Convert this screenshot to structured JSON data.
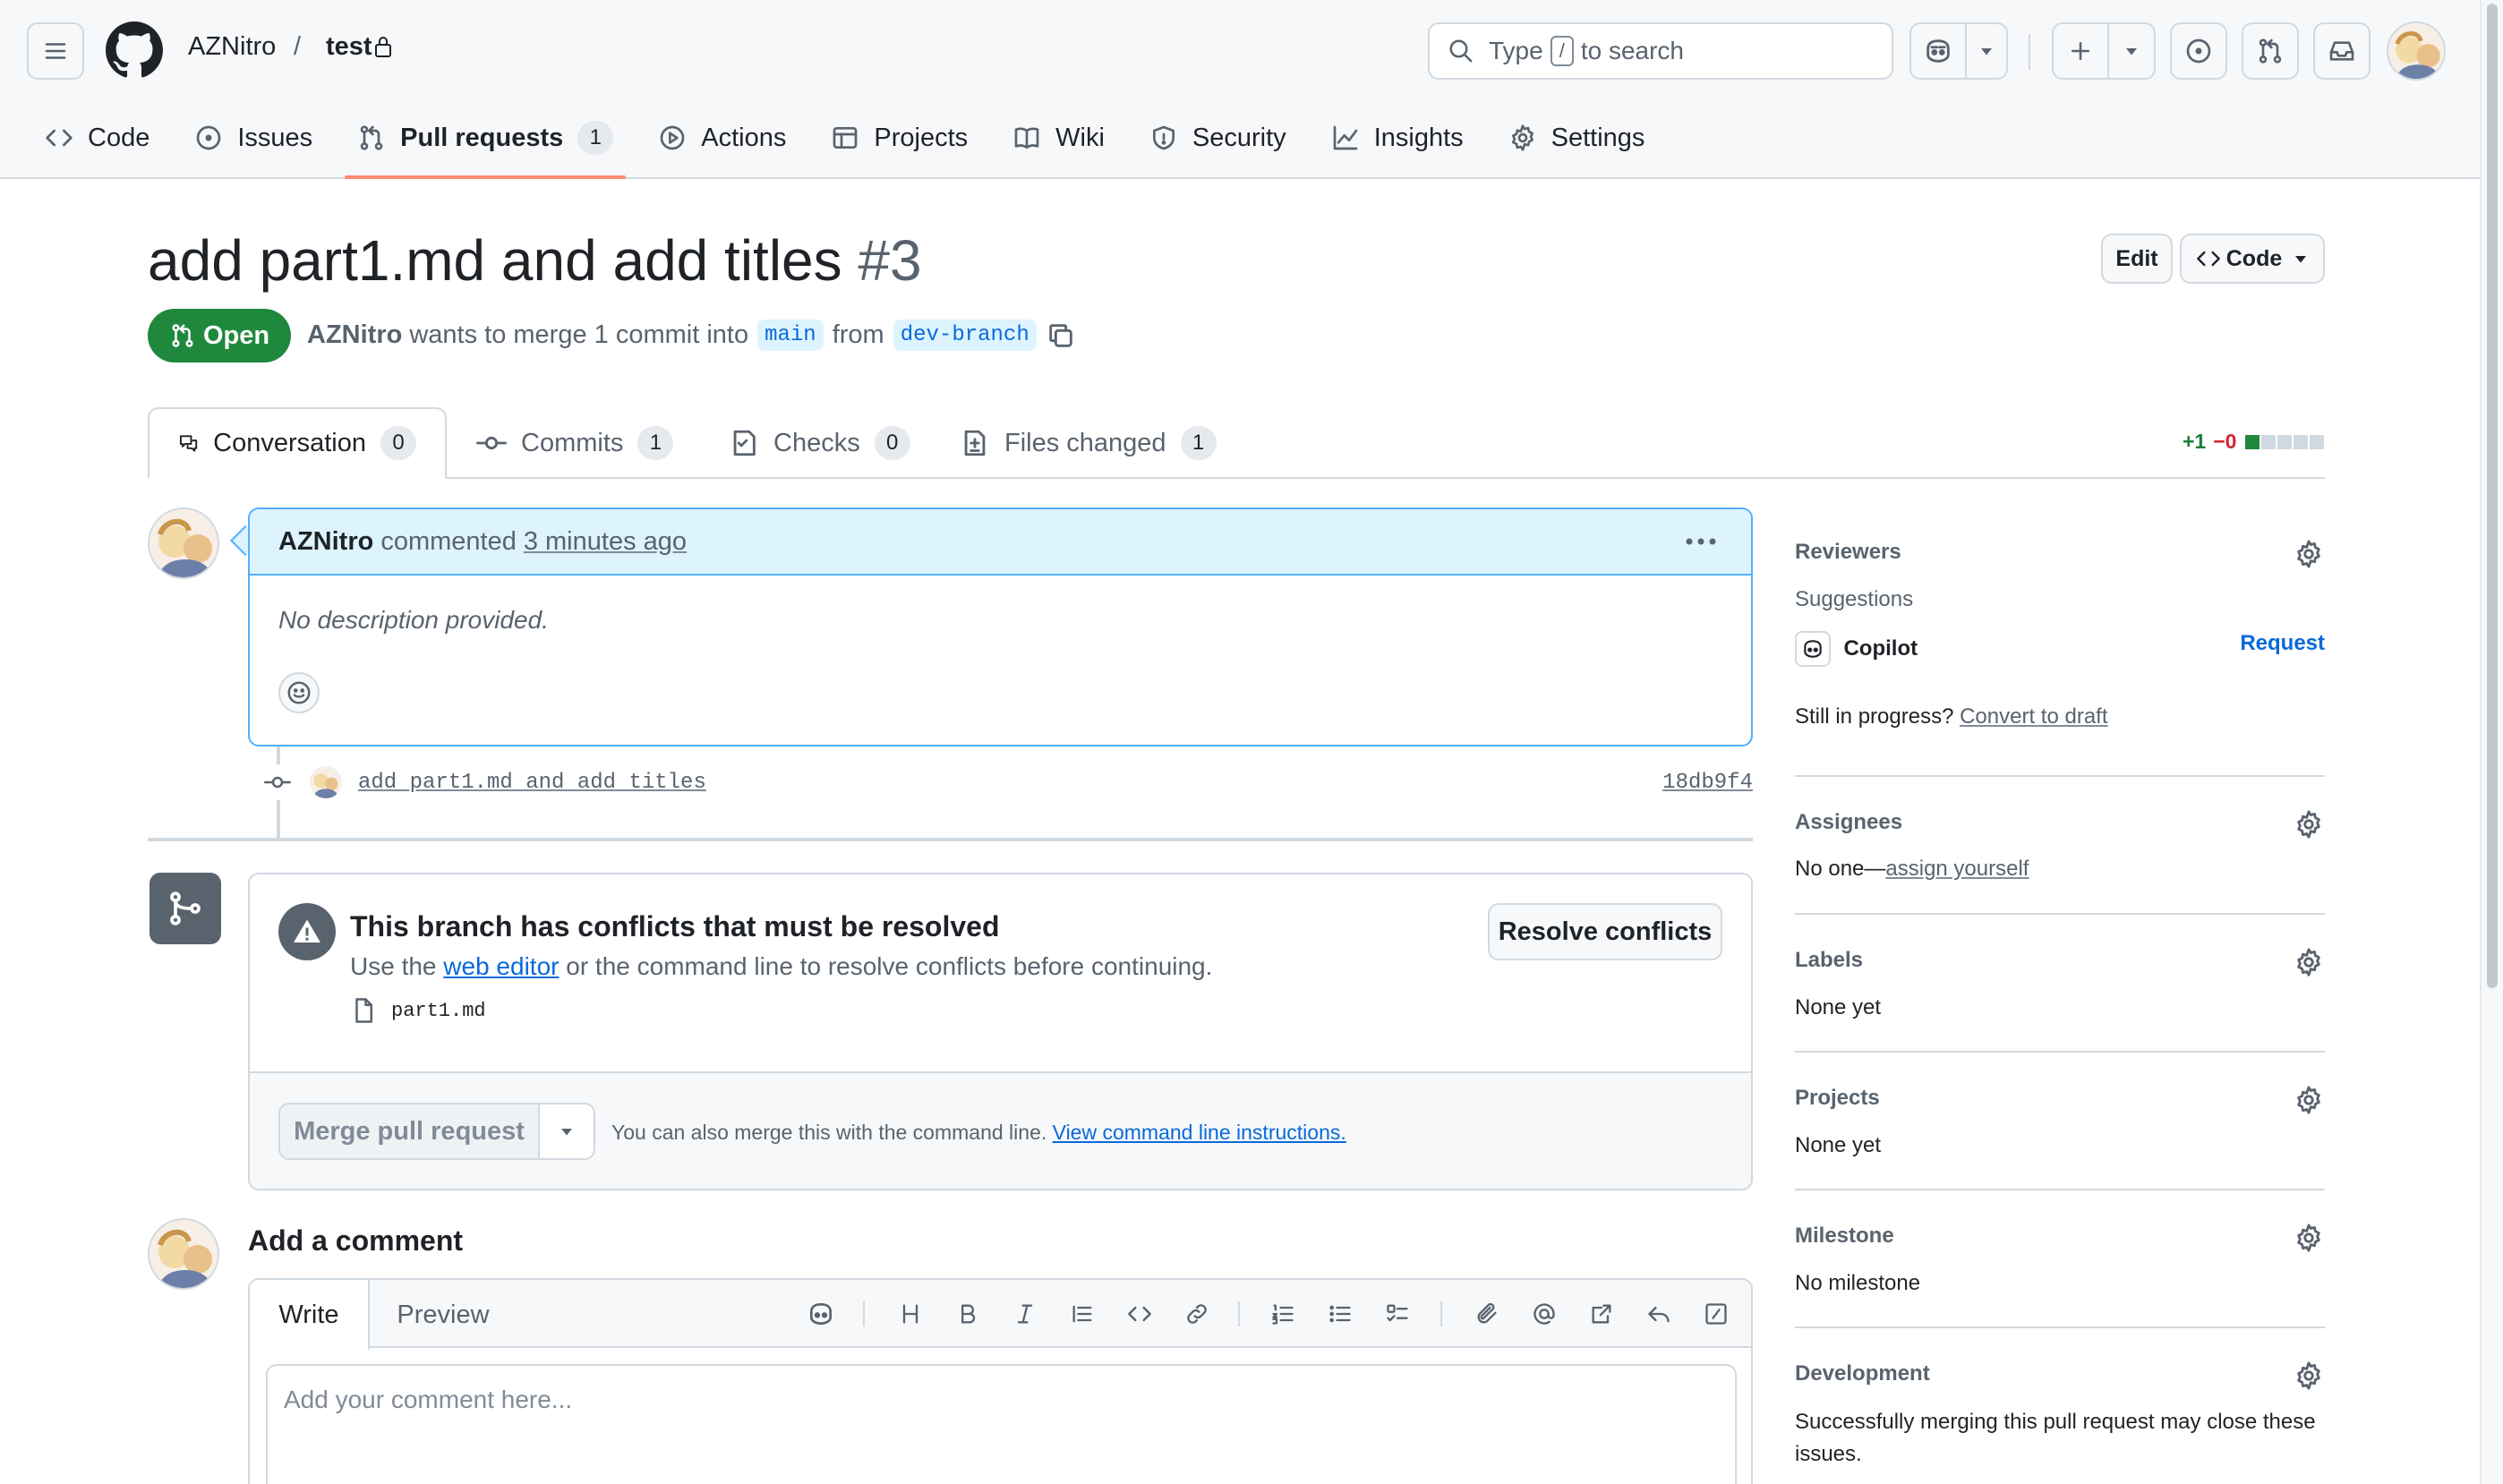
{
  "header": {
    "owner": "AZNitro",
    "separator": "/",
    "repo": "test",
    "search_prefix": "Type",
    "search_key": "/",
    "search_suffix": "to search"
  },
  "repo_nav": {
    "items": [
      {
        "label": "Code",
        "icon": "code-icon"
      },
      {
        "label": "Issues",
        "icon": "issue-opened-icon"
      },
      {
        "label": "Pull requests",
        "icon": "git-pull-request-icon",
        "count": "1",
        "active": true
      },
      {
        "label": "Actions",
        "icon": "play-icon"
      },
      {
        "label": "Projects",
        "icon": "table-icon"
      },
      {
        "label": "Wiki",
        "icon": "book-icon"
      },
      {
        "label": "Security",
        "icon": "shield-icon"
      },
      {
        "label": "Insights",
        "icon": "graph-icon"
      },
      {
        "label": "Settings",
        "icon": "gear-icon"
      }
    ]
  },
  "pr": {
    "title": "add part1.md and add titles",
    "number": "#3",
    "edit_label": "Edit",
    "code_label": "Code",
    "state": "Open",
    "author": "AZNitro",
    "meta_text": "wants to merge 1 commit into",
    "base_branch": "main",
    "from_text": "from",
    "head_branch": "dev-branch"
  },
  "tabs": [
    {
      "label": "Conversation",
      "count": "0",
      "icon": "comment-discussion-icon",
      "active": true
    },
    {
      "label": "Commits",
      "count": "1",
      "icon": "git-commit-icon"
    },
    {
      "label": "Checks",
      "count": "0",
      "icon": "checklist-icon"
    },
    {
      "label": "Files changed",
      "count": "1",
      "icon": "file-diff-icon"
    }
  ],
  "diffstat": {
    "additions": "+1",
    "deletions": "−0",
    "green_blocks": 1,
    "total_blocks": 5
  },
  "comment": {
    "author": "AZNitro",
    "action": "commented",
    "time": "3 minutes ago",
    "body": "No description provided."
  },
  "commit": {
    "message": "add part1.md and add titles",
    "sha": "18db9f4"
  },
  "merge": {
    "conflict_title": "This branch has conflicts that must be resolved",
    "desc_before": "Use the",
    "desc_link": "web editor",
    "desc_after": "or the command line to resolve conflicts before continuing.",
    "file": "part1.md",
    "resolve_label": "Resolve conflicts",
    "merge_label": "Merge pull request",
    "note_text": "You can also merge this with the command line.",
    "note_link": "View command line instructions."
  },
  "add_comment": {
    "title": "Add a comment",
    "write_tab": "Write",
    "preview_tab": "Preview",
    "placeholder": "Add your comment here..."
  },
  "sidebar": {
    "reviewers": {
      "heading": "Reviewers",
      "suggestions": "Suggestions",
      "suggested_name": "Copilot",
      "request_label": "Request",
      "draft_prefix": "Still in progress?",
      "draft_link": "Convert to draft"
    },
    "assignees": {
      "heading": "Assignees",
      "value_prefix": "No one—",
      "value_link": "assign yourself"
    },
    "labels": {
      "heading": "Labels",
      "value": "None yet"
    },
    "projects": {
      "heading": "Projects",
      "value": "None yet"
    },
    "milestone": {
      "heading": "Milestone",
      "value": "No milestone"
    },
    "development": {
      "heading": "Development",
      "value": "Successfully merging this pull request may close these issues."
    }
  },
  "colors": {
    "open_green": "#1f883d",
    "link_blue": "#0969da",
    "active_tab_underline": "#fd8c73",
    "comment_header_bg": "#ddf4ff",
    "deletion_red": "#d1242f"
  }
}
